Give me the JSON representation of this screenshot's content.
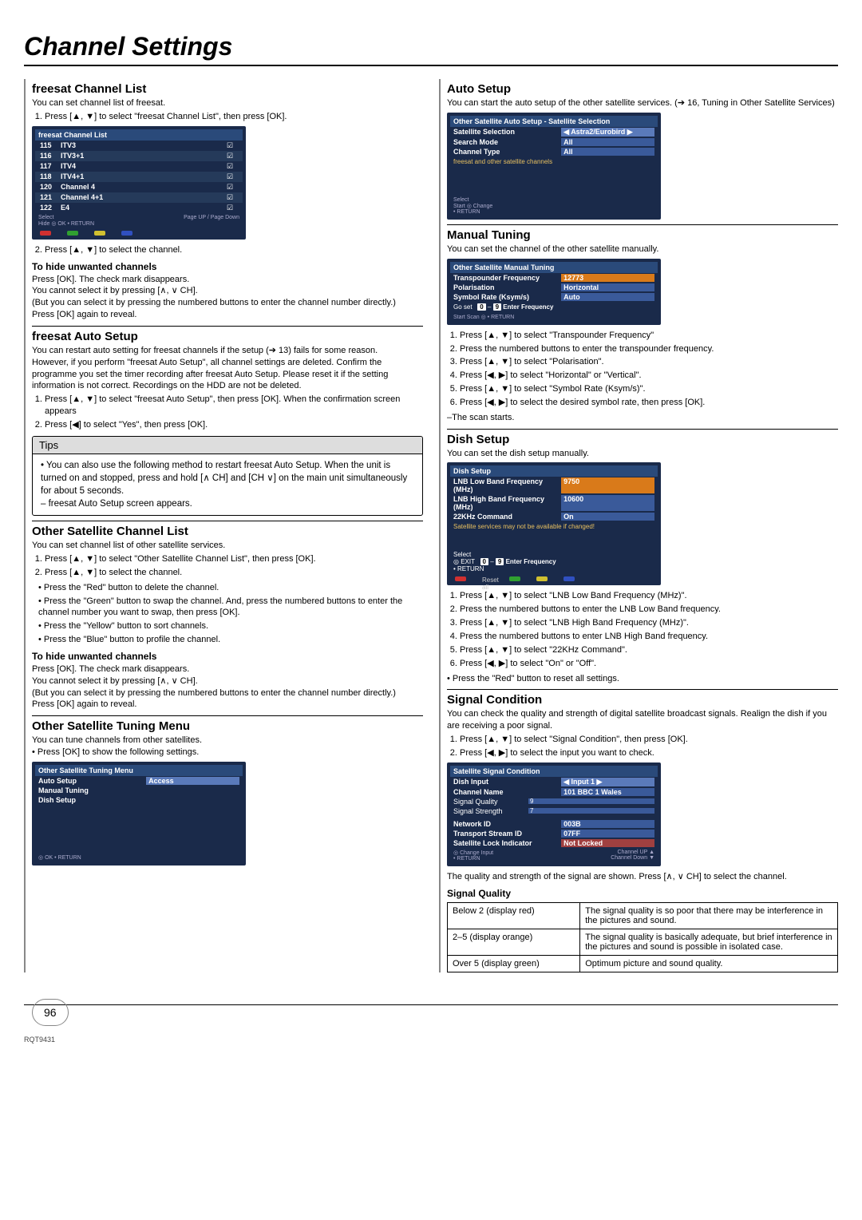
{
  "title": "Channel Settings",
  "left": {
    "freesatList": {
      "heading": "freesat Channel List",
      "intro": "You can set channel list of freesat.",
      "step1": "Press [▲, ▼] to select \"freesat Channel List\", then press [OK].",
      "step2": "Press [▲, ▼] to select the channel.",
      "menuHeader": "freesat Channel List",
      "channels": [
        {
          "num": "115",
          "name": "ITV3"
        },
        {
          "num": "116",
          "name": "ITV3+1"
        },
        {
          "num": "117",
          "name": "ITV4"
        },
        {
          "num": "118",
          "name": "ITV4+1"
        },
        {
          "num": "120",
          "name": "Channel 4"
        },
        {
          "num": "121",
          "name": "Channel 4+1"
        },
        {
          "num": "122",
          "name": "E4"
        }
      ],
      "footerSelect": "Select",
      "footerHide": "Hide",
      "footerOK": "OK",
      "footerReturn": "RETURN",
      "footerPage": "Page UP / Page Down",
      "hideHead": "To hide unwanted channels",
      "hideBody": "Press [OK]. The check mark disappears.\nYou cannot select it by pressing [∧, ∨ CH].\n(But you can select it by pressing the numbered buttons to enter the channel number directly.)\nPress [OK] again to reveal."
    },
    "freesatAuto": {
      "heading": "freesat Auto Setup",
      "body": "You can restart auto setting for freesat channels if the setup (➔ 13) fails for some reason.\nHowever, if you perform \"freesat Auto Setup\", all channel settings are deleted. Confirm the programme you set the timer recording after freesat Auto Setup. Please reset it if the setting information is not correct. Recordings on the HDD are not be deleted.",
      "step1": "Press [▲, ▼] to select \"freesat Auto Setup\", then press [OK]. When the confirmation screen appears",
      "step2": "Press [◀] to select \"Yes\", then press [OK]."
    },
    "tips": {
      "head": "Tips",
      "body": "• You can also use the following method to restart freesat Auto Setup. When the unit is turned on and stopped, press and hold [∧ CH] and [CH ∨] on the main unit simultaneously for about 5 seconds.\n  – freesat Auto Setup screen appears."
    },
    "otherList": {
      "heading": "Other Satellite Channel List",
      "intro": "You can set channel list of other satellite services.",
      "step1": "Press [▲, ▼] to select \"Other Satellite Channel List\", then press [OK].",
      "step2": "Press [▲, ▼] to select the channel.",
      "b1": "Press the \"Red\" button to delete the channel.",
      "b2": "Press the \"Green\" button to swap the channel. And, press the numbered buttons to enter the channel number you want to swap, then press [OK].",
      "b3": "Press the \"Yellow\" button to sort channels.",
      "b4": "Press the \"Blue\" button to profile the channel.",
      "hideHead": "To hide unwanted channels",
      "hideBody": "Press [OK]. The check mark disappears.\nYou cannot select it by pressing [∧, ∨ CH].\n(But you can select it by pressing the numbered buttons to enter the channel number directly.)\nPress [OK] again to reveal."
    },
    "otherTuning": {
      "heading": "Other Satellite Tuning Menu",
      "intro": "You can tune channels from other satellites.",
      "b1": "Press [OK] to show the following settings.",
      "menuHeader": "Other Satellite Tuning Menu",
      "rows": [
        {
          "label": "Auto Setup",
          "value": "Access"
        },
        {
          "label": "Manual Tuning",
          "value": ""
        },
        {
          "label": "Dish Setup",
          "value": ""
        }
      ],
      "footerOK": "OK",
      "footerReturn": "RETURN"
    }
  },
  "right": {
    "autoSetup": {
      "heading": "Auto Setup",
      "intro": "You can start the auto setup of the other satellite services. (➔ 16, Tuning in Other Satellite Services)",
      "menuHeader": "Other Satellite Auto Setup - Satellite Selection",
      "rows": [
        {
          "label": "Satellite Selection",
          "value": "Astra2/Eurobird"
        },
        {
          "label": "Search Mode",
          "value": "All"
        },
        {
          "label": "Channel Type",
          "value": "All"
        }
      ],
      "note": "freesat and other satellite channels",
      "footerSelect": "Select",
      "footerStart": "Start",
      "footerChange": "Change",
      "footerReturn": "RETURN"
    },
    "manualTuning": {
      "heading": "Manual Tuning",
      "intro": "You can set the channel of the other satellite manually.",
      "menuHeader": "Other Satellite Manual Tuning",
      "rows": [
        {
          "label": "Transpounder Frequency",
          "value": "12773"
        },
        {
          "label": "Polarisation",
          "value": "Horizontal"
        },
        {
          "label": "Symbol Rate (Ksym/s)",
          "value": "Auto"
        }
      ],
      "keyhelp": "0 – 9  Enter Frequency",
      "footerGoset": "Go set",
      "footerStart": "Start Scan",
      "footerReturn": "RETURN",
      "s1": "Press [▲, ▼] to select \"Transpounder Frequency\"",
      "s2": "Press the numbered buttons to enter the transpounder frequency.",
      "s3": "Press [▲, ▼] to select \"Polarisation\".",
      "s4": "Press [◀, ▶] to select \"Horizontal\" or \"Vertical\".",
      "s5": "Press [▲, ▼] to select \"Symbol Rate (Ksym/s)\".",
      "s6": "Press [◀, ▶] to select the desired symbol rate, then press [OK].",
      "end": "–The scan starts."
    },
    "dishSetup": {
      "heading": "Dish Setup",
      "intro": "You can set the dish setup manually.",
      "menuHeader": "Dish Setup",
      "rows": [
        {
          "label": "LNB Low Band Frequency (MHz)",
          "value": "9750"
        },
        {
          "label": "LNB High Band Frequency (MHz)",
          "value": "10600"
        },
        {
          "label": "22KHz Command",
          "value": "On"
        }
      ],
      "note": "Satellite services may not be available if changed!",
      "keyhelp": "0 – 9  Enter Frequency",
      "footerSelect": "Select",
      "footerExit": "EXIT",
      "footerReturn": "RETURN",
      "footerReset": "Reset all",
      "s1": "Press [▲, ▼] to select \"LNB Low Band Frequency (MHz)\".",
      "s2": "Press the numbered buttons to enter the LNB Low Band frequency.",
      "s3": "Press [▲, ▼] to select \"LNB High Band Frequency (MHz)\".",
      "s4": "Press the numbered buttons to enter LNB High Band frequency.",
      "s5": "Press [▲, ▼] to select \"22KHz Command\".",
      "s6": "Press [◀, ▶] to select \"On\" or \"Off\".",
      "b1": "Press the \"Red\" button to reset all settings."
    },
    "signal": {
      "heading": "Signal Condition",
      "intro": "You can check the quality and strength of digital satellite broadcast signals. Realign the dish if you are receiving a poor signal.",
      "s1": "Press [▲, ▼] to select \"Signal Condition\", then press [OK].",
      "s2": "Press [◀, ▶] to select the input you want to check.",
      "menuHeader": "Satellite Signal Condition",
      "rows": [
        {
          "label": "Dish Input",
          "value": "Input 1"
        },
        {
          "label": "Channel Name",
          "value": "101 BBC 1 Wales"
        },
        {
          "label": "Signal Quality",
          "value": "9"
        },
        {
          "label": "Signal Strength",
          "value": "7"
        },
        {
          "label": "Network ID",
          "value": "003B"
        },
        {
          "label": "Transport Stream ID",
          "value": "07FF"
        },
        {
          "label": "Satellite Lock Indicator",
          "value": "Not Locked"
        }
      ],
      "footerChangeInput": "Change Input",
      "footerReturn": "RETURN",
      "footerChUp": "Channel UP",
      "footerChDown": "Channel Down",
      "after": "The quality and strength of the signal are shown. Press [∧, ∨ CH] to select the channel.",
      "sqHead": "Signal Quality",
      "table": [
        {
          "a": "Below 2 (display red)",
          "b": "The signal quality is so poor that there may be interference in the pictures and sound."
        },
        {
          "a": "2–5 (display orange)",
          "b": "The signal quality is basically adequate, but brief interference in the pictures and sound is possible in isolated case."
        },
        {
          "a": "Over 5 (display green)",
          "b": "Optimum picture and sound quality."
        }
      ]
    }
  },
  "pageNumber": "96",
  "docCode": "RQT9431"
}
